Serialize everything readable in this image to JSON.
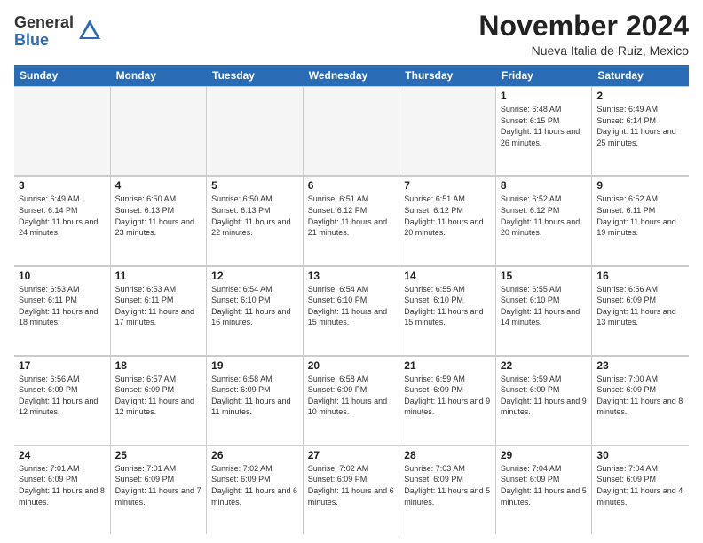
{
  "logo": {
    "general": "General",
    "blue": "Blue"
  },
  "title": "November 2024",
  "location": "Nueva Italia de Ruiz, Mexico",
  "header_days": [
    "Sunday",
    "Monday",
    "Tuesday",
    "Wednesday",
    "Thursday",
    "Friday",
    "Saturday"
  ],
  "weeks": [
    [
      {
        "day": "",
        "info": "",
        "empty": true
      },
      {
        "day": "",
        "info": "",
        "empty": true
      },
      {
        "day": "",
        "info": "",
        "empty": true
      },
      {
        "day": "",
        "info": "",
        "empty": true
      },
      {
        "day": "",
        "info": "",
        "empty": true
      },
      {
        "day": "1",
        "info": "Sunrise: 6:48 AM\nSunset: 6:15 PM\nDaylight: 11 hours and 26 minutes."
      },
      {
        "day": "2",
        "info": "Sunrise: 6:49 AM\nSunset: 6:14 PM\nDaylight: 11 hours and 25 minutes."
      }
    ],
    [
      {
        "day": "3",
        "info": "Sunrise: 6:49 AM\nSunset: 6:14 PM\nDaylight: 11 hours and 24 minutes."
      },
      {
        "day": "4",
        "info": "Sunrise: 6:50 AM\nSunset: 6:13 PM\nDaylight: 11 hours and 23 minutes."
      },
      {
        "day": "5",
        "info": "Sunrise: 6:50 AM\nSunset: 6:13 PM\nDaylight: 11 hours and 22 minutes."
      },
      {
        "day": "6",
        "info": "Sunrise: 6:51 AM\nSunset: 6:12 PM\nDaylight: 11 hours and 21 minutes."
      },
      {
        "day": "7",
        "info": "Sunrise: 6:51 AM\nSunset: 6:12 PM\nDaylight: 11 hours and 20 minutes."
      },
      {
        "day": "8",
        "info": "Sunrise: 6:52 AM\nSunset: 6:12 PM\nDaylight: 11 hours and 20 minutes."
      },
      {
        "day": "9",
        "info": "Sunrise: 6:52 AM\nSunset: 6:11 PM\nDaylight: 11 hours and 19 minutes."
      }
    ],
    [
      {
        "day": "10",
        "info": "Sunrise: 6:53 AM\nSunset: 6:11 PM\nDaylight: 11 hours and 18 minutes."
      },
      {
        "day": "11",
        "info": "Sunrise: 6:53 AM\nSunset: 6:11 PM\nDaylight: 11 hours and 17 minutes."
      },
      {
        "day": "12",
        "info": "Sunrise: 6:54 AM\nSunset: 6:10 PM\nDaylight: 11 hours and 16 minutes."
      },
      {
        "day": "13",
        "info": "Sunrise: 6:54 AM\nSunset: 6:10 PM\nDaylight: 11 hours and 15 minutes."
      },
      {
        "day": "14",
        "info": "Sunrise: 6:55 AM\nSunset: 6:10 PM\nDaylight: 11 hours and 15 minutes."
      },
      {
        "day": "15",
        "info": "Sunrise: 6:55 AM\nSunset: 6:10 PM\nDaylight: 11 hours and 14 minutes."
      },
      {
        "day": "16",
        "info": "Sunrise: 6:56 AM\nSunset: 6:09 PM\nDaylight: 11 hours and 13 minutes."
      }
    ],
    [
      {
        "day": "17",
        "info": "Sunrise: 6:56 AM\nSunset: 6:09 PM\nDaylight: 11 hours and 12 minutes."
      },
      {
        "day": "18",
        "info": "Sunrise: 6:57 AM\nSunset: 6:09 PM\nDaylight: 11 hours and 12 minutes."
      },
      {
        "day": "19",
        "info": "Sunrise: 6:58 AM\nSunset: 6:09 PM\nDaylight: 11 hours and 11 minutes."
      },
      {
        "day": "20",
        "info": "Sunrise: 6:58 AM\nSunset: 6:09 PM\nDaylight: 11 hours and 10 minutes."
      },
      {
        "day": "21",
        "info": "Sunrise: 6:59 AM\nSunset: 6:09 PM\nDaylight: 11 hours and 9 minutes."
      },
      {
        "day": "22",
        "info": "Sunrise: 6:59 AM\nSunset: 6:09 PM\nDaylight: 11 hours and 9 minutes."
      },
      {
        "day": "23",
        "info": "Sunrise: 7:00 AM\nSunset: 6:09 PM\nDaylight: 11 hours and 8 minutes."
      }
    ],
    [
      {
        "day": "24",
        "info": "Sunrise: 7:01 AM\nSunset: 6:09 PM\nDaylight: 11 hours and 8 minutes."
      },
      {
        "day": "25",
        "info": "Sunrise: 7:01 AM\nSunset: 6:09 PM\nDaylight: 11 hours and 7 minutes."
      },
      {
        "day": "26",
        "info": "Sunrise: 7:02 AM\nSunset: 6:09 PM\nDaylight: 11 hours and 6 minutes."
      },
      {
        "day": "27",
        "info": "Sunrise: 7:02 AM\nSunset: 6:09 PM\nDaylight: 11 hours and 6 minutes."
      },
      {
        "day": "28",
        "info": "Sunrise: 7:03 AM\nSunset: 6:09 PM\nDaylight: 11 hours and 5 minutes."
      },
      {
        "day": "29",
        "info": "Sunrise: 7:04 AM\nSunset: 6:09 PM\nDaylight: 11 hours and 5 minutes."
      },
      {
        "day": "30",
        "info": "Sunrise: 7:04 AM\nSunset: 6:09 PM\nDaylight: 11 hours and 4 minutes."
      }
    ]
  ]
}
